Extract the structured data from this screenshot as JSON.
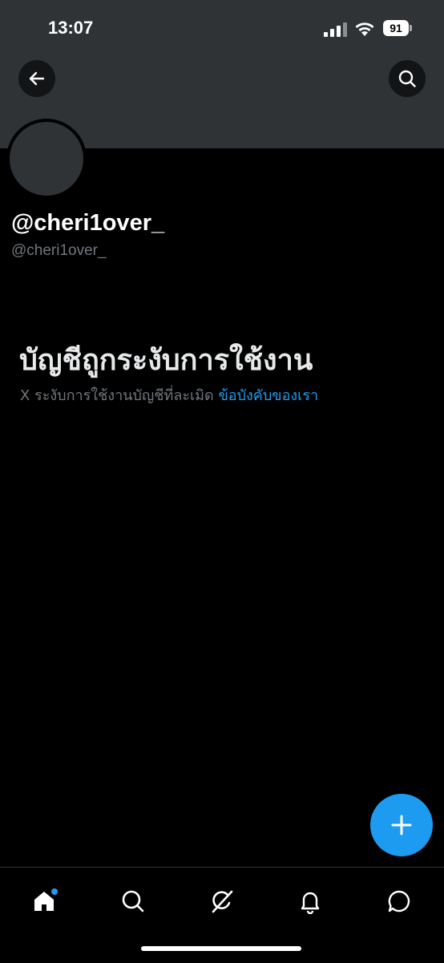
{
  "status_bar": {
    "time": "13:07",
    "battery": "91",
    "icons": [
      "signal-icon",
      "wifi-icon",
      "battery-icon"
    ]
  },
  "header": {
    "back_icon": "arrow-left-icon",
    "search_icon": "search-icon"
  },
  "profile": {
    "display_name": "@cheri1over_",
    "handle": "@cheri1over_"
  },
  "suspension": {
    "title": "บัญชีถูกระงับการใช้งาน",
    "message": "X ระงับการใช้งานบัญชีที่ละเมิด",
    "link_text": "ข้อบังคับของเรา"
  },
  "fab": {
    "icon": "plus-icon"
  },
  "bottom_nav": {
    "items": [
      {
        "icon": "home-icon",
        "has_badge": true
      },
      {
        "icon": "search-icon"
      },
      {
        "icon": "grok-icon"
      },
      {
        "icon": "bell-icon"
      },
      {
        "icon": "message-icon"
      }
    ]
  },
  "colors": {
    "accent": "#1d9bf0",
    "background": "#000000",
    "banner": "#2f3336",
    "secondary_text": "#71767b"
  }
}
